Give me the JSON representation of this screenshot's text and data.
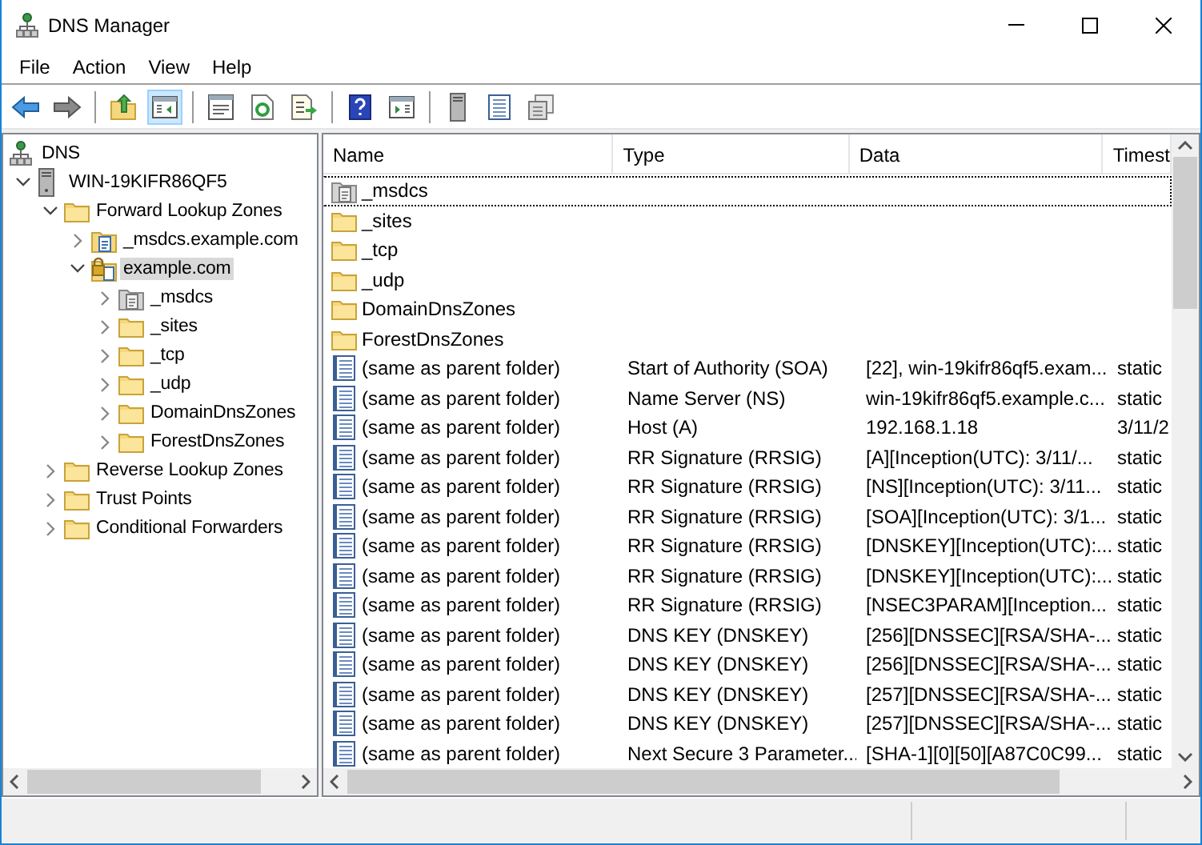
{
  "window": {
    "title": "DNS Manager"
  },
  "menu": [
    {
      "label": "File"
    },
    {
      "label": "Action"
    },
    {
      "label": "View"
    },
    {
      "label": "Help"
    }
  ],
  "toolbar": [
    [
      {
        "kind": "back",
        "pressed": false
      },
      {
        "kind": "forward",
        "pressed": false
      }
    ],
    [
      {
        "kind": "up",
        "pressed": false
      },
      {
        "kind": "console-tree",
        "pressed": true
      }
    ],
    [
      {
        "kind": "properties",
        "pressed": false
      },
      {
        "kind": "refresh",
        "pressed": false
      },
      {
        "kind": "export",
        "pressed": false
      }
    ],
    [
      {
        "kind": "help",
        "pressed": false
      },
      {
        "kind": "action-pane",
        "pressed": false
      }
    ],
    [
      {
        "kind": "server",
        "pressed": false
      },
      {
        "kind": "records",
        "pressed": false
      },
      {
        "kind": "copy",
        "pressed": false
      }
    ]
  ],
  "tree": [
    {
      "label": "DNS",
      "kind": "dns",
      "selected": false,
      "children": [
        {
          "label": "WIN-19KIFR86QF5",
          "kind": "server",
          "expanded": true,
          "selected": false,
          "children": [
            {
              "label": "Forward Lookup Zones",
              "kind": "folder",
              "expanded": true,
              "selected": false,
              "children": [
                {
                  "label": "_msdcs.example.com",
                  "kind": "zone",
                  "expanded": false,
                  "selected": false
                },
                {
                  "label": "example.com",
                  "kind": "zone-locked",
                  "expanded": true,
                  "selected": true,
                  "children": [
                    {
                      "label": "_msdcs",
                      "kind": "delegation",
                      "expanded": false,
                      "selected": false
                    },
                    {
                      "label": "_sites",
                      "kind": "folder",
                      "expanded": false,
                      "selected": false
                    },
                    {
                      "label": "_tcp",
                      "kind": "folder",
                      "expanded": false,
                      "selected": false
                    },
                    {
                      "label": "_udp",
                      "kind": "folder",
                      "expanded": false,
                      "selected": false
                    },
                    {
                      "label": "DomainDnsZones",
                      "kind": "folder",
                      "expanded": false,
                      "selected": false
                    },
                    {
                      "label": "ForestDnsZones",
                      "kind": "folder",
                      "expanded": false,
                      "selected": false
                    }
                  ]
                }
              ]
            },
            {
              "label": "Reverse Lookup Zones",
              "kind": "folder",
              "expanded": false,
              "selected": false
            },
            {
              "label": "Trust Points",
              "kind": "folder",
              "expanded": false,
              "selected": false
            },
            {
              "label": "Conditional Forwarders",
              "kind": "folder",
              "expanded": false,
              "selected": false
            }
          ]
        }
      ]
    }
  ],
  "list": {
    "columns": [
      "Name",
      "Type",
      "Data",
      "Timest"
    ],
    "rows": [
      {
        "kind": "delegation",
        "name": "_msdcs",
        "focused": true
      },
      {
        "kind": "folder",
        "name": "_sites",
        "focused": false
      },
      {
        "kind": "folder",
        "name": "_tcp",
        "focused": false
      },
      {
        "kind": "folder",
        "name": "_udp",
        "focused": false
      },
      {
        "kind": "folder",
        "name": "DomainDnsZones",
        "focused": false
      },
      {
        "kind": "folder",
        "name": "ForestDnsZones",
        "focused": false
      },
      {
        "kind": "record",
        "name": "(same as parent folder)",
        "type": "Start of Authority (SOA)",
        "data": "[22], win-19kifr86qf5.exam...",
        "timestamp": "static",
        "focused": false
      },
      {
        "kind": "record",
        "name": "(same as parent folder)",
        "type": "Name Server (NS)",
        "data": "win-19kifr86qf5.example.c...",
        "timestamp": "static",
        "focused": false
      },
      {
        "kind": "record",
        "name": "(same as parent folder)",
        "type": "Host (A)",
        "data": "192.168.1.18",
        "timestamp": "3/11/2",
        "focused": false
      },
      {
        "kind": "record",
        "name": "(same as parent folder)",
        "type": "RR Signature (RRSIG)",
        "data": "[A][Inception(UTC): 3/11/...",
        "timestamp": "static",
        "focused": false
      },
      {
        "kind": "record",
        "name": "(same as parent folder)",
        "type": "RR Signature (RRSIG)",
        "data": "[NS][Inception(UTC): 3/11...",
        "timestamp": "static",
        "focused": false
      },
      {
        "kind": "record",
        "name": "(same as parent folder)",
        "type": "RR Signature (RRSIG)",
        "data": "[SOA][Inception(UTC): 3/1...",
        "timestamp": "static",
        "focused": false
      },
      {
        "kind": "record",
        "name": "(same as parent folder)",
        "type": "RR Signature (RRSIG)",
        "data": "[DNSKEY][Inception(UTC):...",
        "timestamp": "static",
        "focused": false
      },
      {
        "kind": "record",
        "name": "(same as parent folder)",
        "type": "RR Signature (RRSIG)",
        "data": "[DNSKEY][Inception(UTC):...",
        "timestamp": "static",
        "focused": false
      },
      {
        "kind": "record",
        "name": "(same as parent folder)",
        "type": "RR Signature (RRSIG)",
        "data": "[NSEC3PARAM][Inception...",
        "timestamp": "static",
        "focused": false
      },
      {
        "kind": "record",
        "name": "(same as parent folder)",
        "type": "DNS KEY (DNSKEY)",
        "data": "[256][DNSSEC][RSA/SHA-...",
        "timestamp": "static",
        "focused": false
      },
      {
        "kind": "record",
        "name": "(same as parent folder)",
        "type": "DNS KEY (DNSKEY)",
        "data": "[256][DNSSEC][RSA/SHA-...",
        "timestamp": "static",
        "focused": false
      },
      {
        "kind": "record",
        "name": "(same as parent folder)",
        "type": "DNS KEY (DNSKEY)",
        "data": "[257][DNSSEC][RSA/SHA-...",
        "timestamp": "static",
        "focused": false
      },
      {
        "kind": "record",
        "name": "(same as parent folder)",
        "type": "DNS KEY (DNSKEY)",
        "data": "[257][DNSSEC][RSA/SHA-...",
        "timestamp": "static",
        "focused": false
      },
      {
        "kind": "record",
        "name": "(same as parent folder)",
        "type": "Next Secure 3 Parameter...",
        "data": "[SHA-1][0][50][A87C0C99...",
        "timestamp": "static",
        "focused": false
      }
    ]
  }
}
